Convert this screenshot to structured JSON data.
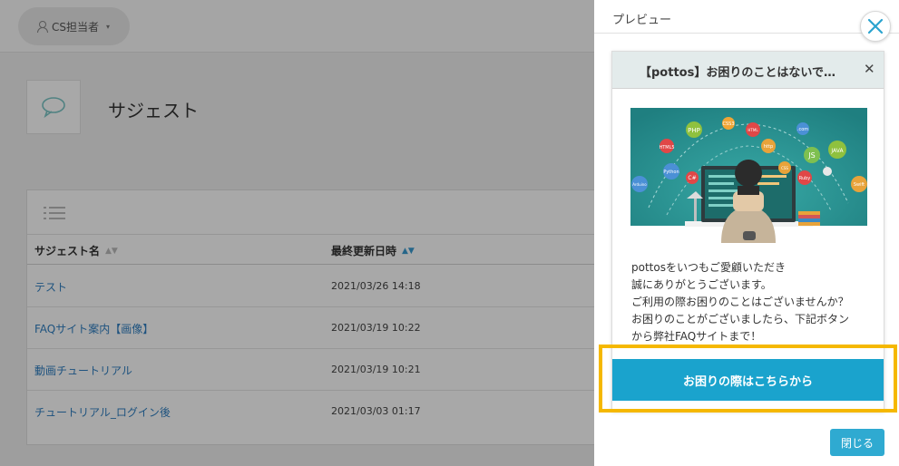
{
  "header": {
    "user_label": "CS担当者",
    "caret": "▾"
  },
  "page": {
    "title": "サジェスト"
  },
  "table": {
    "columns": [
      "サジェスト名",
      "最終更新日時"
    ],
    "sort_icons": [
      "▲▼",
      "▲▼"
    ],
    "rows": [
      {
        "name": "テスト",
        "updated": "2021/03/26 14:18"
      },
      {
        "name": "FAQサイト案内【画像】",
        "updated": "2021/03/19 10:22"
      },
      {
        "name": "動画チュートリアル",
        "updated": "2021/03/19 10:21"
      },
      {
        "name": "チュートリアル_ログイン後",
        "updated": "2021/03/03 01:17"
      }
    ]
  },
  "preview": {
    "title": "プレビュー",
    "close_icon": "close-icon",
    "widget": {
      "title": "【pottos】お困りのことはないで…",
      "close_glyph": "✕",
      "hero_labels": [
        "PHP",
        "HTML5",
        "CSS3",
        "http",
        "JS",
        "JAVA",
        "Python",
        "C#",
        "Ruby",
        "Swift",
        "Arduino",
        ".com",
        "CSS",
        "HTML"
      ],
      "body_lines": [
        "pottosをいつもご愛顧いただき",
        "誠にありがとうございます。",
        "ご利用の際お困りのことはございませんか？",
        "お困りのことがございましたら、下記ボタン",
        "から弊社FAQサイトまで！"
      ],
      "cta_label": "お困りの際はこちらから"
    },
    "close_button": "閉じる"
  },
  "colors": {
    "accent": "#1aa3cd",
    "highlight": "#f5b800",
    "link": "#2f7fc1"
  }
}
